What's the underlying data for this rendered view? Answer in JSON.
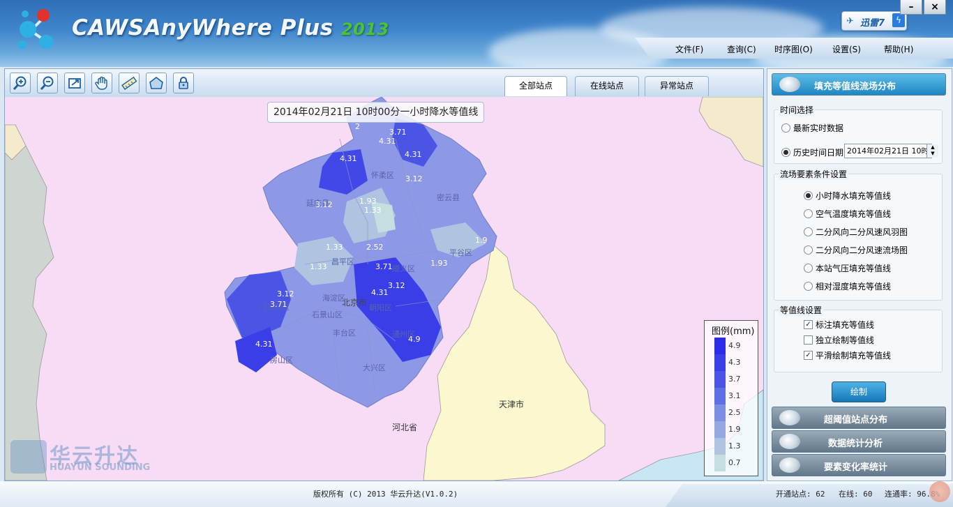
{
  "header": {
    "title": "CAWSAnyWhere Plus",
    "year": "2013",
    "badge": "迅雷7",
    "window_controls": [
      "–",
      "×"
    ]
  },
  "menu": [
    "文件(F)",
    "查询(C)",
    "时序图(O)",
    "设置(S)",
    "帮助(H)"
  ],
  "toolbar": {
    "tools": [
      "zoom-in-icon",
      "zoom-out-icon",
      "full-extent-icon",
      "pan-hand-icon",
      "ruler-icon",
      "home-icon",
      "lock-icon"
    ],
    "tabs": [
      "全部站点",
      "在线站点",
      "异常站点"
    ]
  },
  "map": {
    "title": "2014年02月21日  10时00分一小时降水等值线",
    "place_labels": [
      "天津市",
      "河北省",
      "北京市",
      "昌平区",
      "平谷区",
      "密云县",
      "顺义区",
      "通州区",
      "大兴区",
      "房山区",
      "门头沟区",
      "延庆县",
      "怀柔区",
      "丰台区",
      "石景山区",
      "朝阳区",
      "海淀区"
    ],
    "value_labels": [
      "2",
      "3.71",
      "4.31",
      "4.31",
      "4.31",
      "3.12",
      "3.12",
      "1.93",
      "1.33",
      "1.33",
      "2.52",
      "1.33",
      "3.71",
      "1.93",
      "1.9",
      "3.12",
      "3.71",
      "4.31",
      "3.12",
      "4.31",
      "4.9"
    ],
    "legend": {
      "title": "图例(mm)",
      "values": [
        "4.9",
        "4.3",
        "3.7",
        "3.1",
        "2.5",
        "1.9",
        "1.3",
        "0.7"
      ],
      "colors": [
        "#2c2ce6",
        "#3a3ee8",
        "#4a55e6",
        "#5e6ee4",
        "#7c8ee2",
        "#95a8e0",
        "#aec4e0",
        "#c5dedf"
      ]
    },
    "watermark": {
      "cn": "华云升达",
      "en": "HUAYUN SOUNDING"
    }
  },
  "panel": {
    "sections": [
      "填充等值线流场分布",
      "超阈值站点分布",
      "数据统计分析",
      "要素变化率统计"
    ],
    "time_group": {
      "title": "时间选择",
      "latest": "最新实时数据",
      "history": "历史时间日期",
      "date_value": "2014年02月21日  10时"
    },
    "element_group": {
      "title": "流场要素条件设置",
      "options": [
        "小时降水填充等值线",
        "空气温度填充等值线",
        "二分风向二分风速风羽图",
        "二分风向二分风速流场图",
        "本站气压填充等值线",
        "相对湿度填充等值线"
      ],
      "selected_index": 0
    },
    "contour_group": {
      "title": "等值线设置",
      "options": [
        "标注填充等值线",
        "独立绘制等值线",
        "平滑绘制填充等值线"
      ],
      "checked": [
        true,
        false,
        true
      ]
    },
    "draw_button": "绘制"
  },
  "status": {
    "copyright": "版权所有 (C) 2013 华云升达(V1.0.2)",
    "stations": "开通站点: 62",
    "online": "在线: 60",
    "rate": "连通率: 96.8%"
  }
}
